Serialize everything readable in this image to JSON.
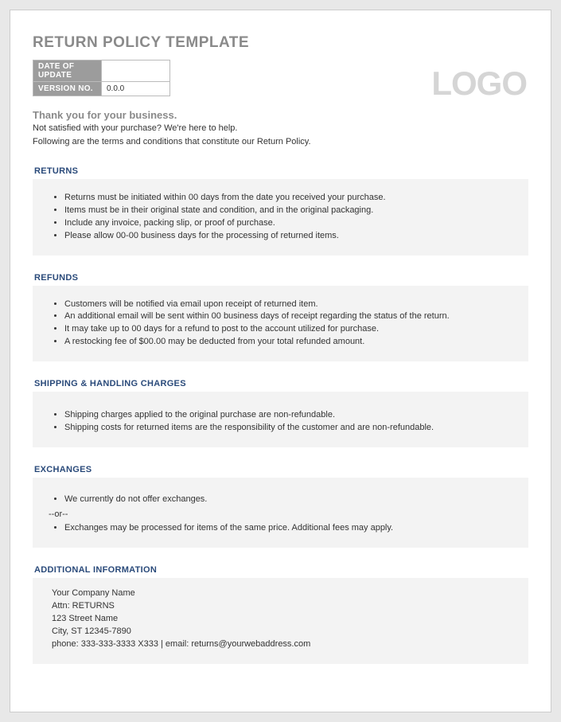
{
  "title": "RETURN POLICY TEMPLATE",
  "meta": {
    "date_label": "DATE OF UPDATE",
    "date_value": "",
    "version_label": "VERSION NO.",
    "version_value": "0.0.0"
  },
  "logo": "LOGO",
  "thanks": "Thank you for your business.",
  "intro1": "Not satisfied with your purchase?  We're here to help.",
  "intro2": "Following are the terms and conditions that constitute our Return Policy.",
  "sections": {
    "returns": {
      "heading": "RETURNS",
      "items": [
        "Returns must be initiated within 00 days from the date you received your purchase.",
        "Items must be in their original state and condition, and in the original packaging.",
        "Include any invoice, packing slip, or proof of purchase.",
        "Please allow 00-00 business days for the processing of returned items."
      ]
    },
    "refunds": {
      "heading": "REFUNDS",
      "items": [
        "Customers will be notified via email upon receipt of returned item.",
        "An additional email will be sent within 00 business days of receipt regarding the status of the return.",
        "It may take up to 00 days for a refund to post to the account utilized for purchase.",
        "A restocking fee of $00.00 may be deducted from your total refunded amount."
      ]
    },
    "shipping": {
      "heading": "SHIPPING & HANDLING CHARGES",
      "items": [
        "Shipping charges applied to the original purchase are non-refundable.",
        "Shipping costs for returned items are the responsibility of the customer and are non-refundable."
      ]
    },
    "exchanges": {
      "heading": "EXCHANGES",
      "item1": "We currently do not offer exchanges.",
      "or": "--or--",
      "item2": "Exchanges may be processed for items of the same price.  Additional fees may apply."
    },
    "additional": {
      "heading": "ADDITIONAL INFORMATION",
      "company": "Your Company Name",
      "attn": "Attn: RETURNS",
      "street": "123 Street Name",
      "citystate": "City, ST  12345-7890",
      "contact": "phone: 333-333-3333 X333    |    email: returns@yourwebaddress.com"
    }
  }
}
